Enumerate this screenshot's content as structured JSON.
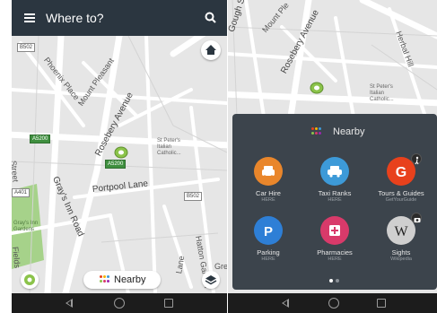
{
  "left_screen": {
    "header": {
      "title": "Where to?",
      "menu_icon": "menu-icon",
      "search_icon": "search-icon"
    },
    "map_labels": {
      "phoenix_place": "Phoenix Place",
      "mount_pleasant": "Mount Pleasant",
      "rosebery_avenue": "Rosebery Avenue",
      "grays_inn_road": "Gray's Inn Road",
      "portpool_lane": "Portpool Lane",
      "st_peters": "St Peter's Italian Catholic...",
      "grays_inn_gardens": "Gray's Inn Gardens",
      "street": "Street",
      "fields": "Fields",
      "hatton_garden": "Hatton Garden",
      "lane": "Lane",
      "gre": "Gre"
    },
    "shields": {
      "b502": "B502",
      "a5200_a": "A5200",
      "a5200_b": "A5200",
      "a401": "A401",
      "b502_b": "B502"
    },
    "nearby_button": {
      "label": "Nearby"
    }
  },
  "right_screen": {
    "map_labels": {
      "gough_street": "Gough Street",
      "mount_ple": "Mount Ple",
      "rosebery_avenue": "Rosebery Avenue",
      "herbal_hill": "Herbal Hill",
      "st_peters": "St Peter's Italian Catholic..."
    },
    "panel": {
      "title": "Nearby",
      "categories": [
        {
          "name": "Car Hire",
          "sub": "HERE",
          "color": "#e9862b",
          "icon": "car-hire-icon"
        },
        {
          "name": "Taxi Ranks",
          "sub": "HERE",
          "color": "#3d9ad8",
          "icon": "taxi-icon"
        },
        {
          "name": "Tours & Guides",
          "sub": "GetYourGuide",
          "color": "#e8411c",
          "icon": "getyourguide-icon"
        },
        {
          "name": "Parking",
          "sub": "HERE",
          "color": "#2e7fd6",
          "icon": "parking-icon"
        },
        {
          "name": "Pharmacies",
          "sub": "HERE",
          "color": "#d83a6a",
          "icon": "pharmacy-icon"
        },
        {
          "name": "Sights",
          "sub": "Wikipedia",
          "color": "#cfcfcf",
          "icon": "wikipedia-icon"
        }
      ],
      "page_count": 2,
      "current_page": 1
    }
  },
  "colors": {
    "header": "#2b3640",
    "panel": "#3c444c",
    "pin": "#8bc34a",
    "park": "#a6d28a"
  }
}
